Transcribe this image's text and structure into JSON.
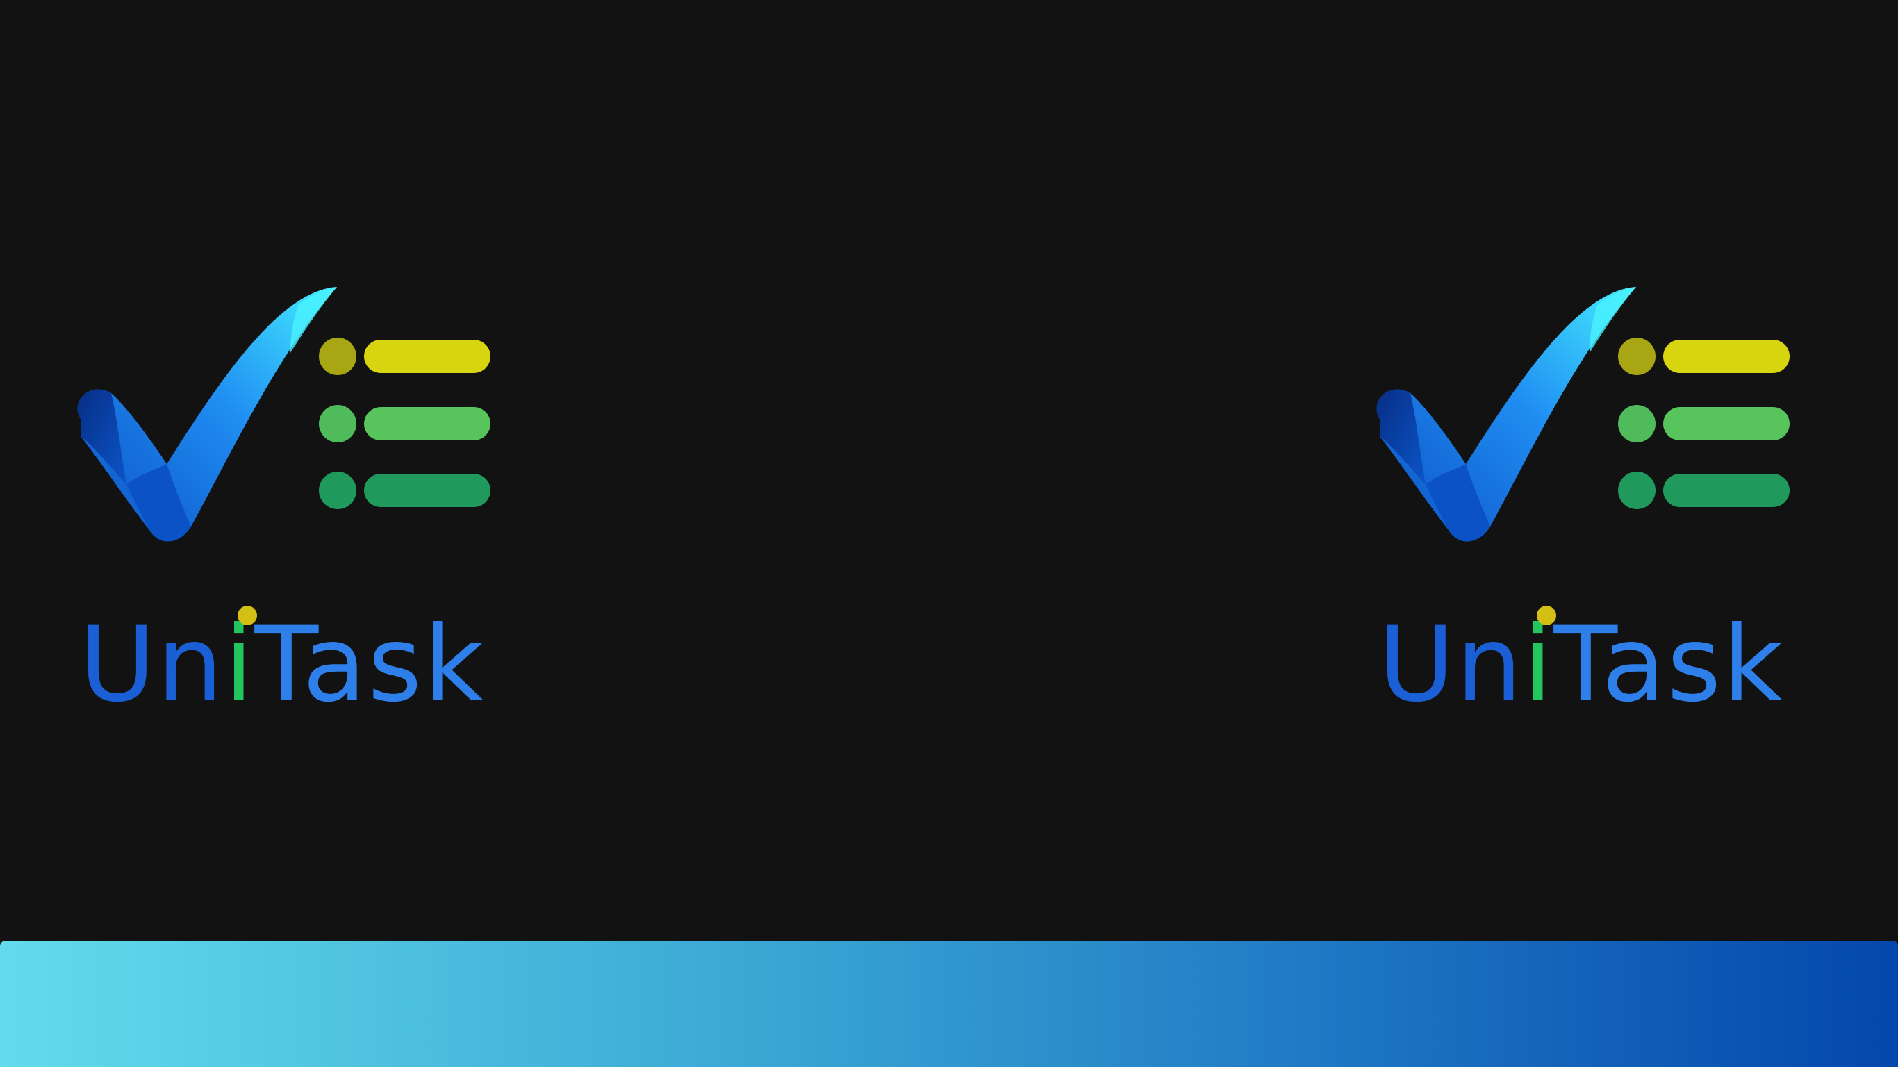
{
  "app": {
    "name_parts": [
      "Un",
      "i",
      "Task"
    ],
    "name": "UniTask"
  },
  "logos": [
    {
      "position": "left",
      "mark": "checkmark-icon",
      "list": "task-list-icon"
    },
    {
      "position": "right",
      "mark": "checkmark-icon",
      "list": "task-list-icon"
    }
  ],
  "colors": {
    "background": "#121212",
    "wordmark_blue": "#1a5fd6",
    "wordmark_light_blue": "#3b8ef0",
    "wordmark_i_green": "#22c55e",
    "i_dot_yellow": "#d4c015",
    "row1_yellow": "#d6d50f",
    "row2_green": "#57c45c",
    "row3_teal": "#1f9a5c",
    "check_cyan": "#3fe5ff",
    "check_blue": "#1f86f0",
    "check_dark": "#0a3a9e",
    "band_start": "#62dcec",
    "band_end": "#0447ac"
  }
}
